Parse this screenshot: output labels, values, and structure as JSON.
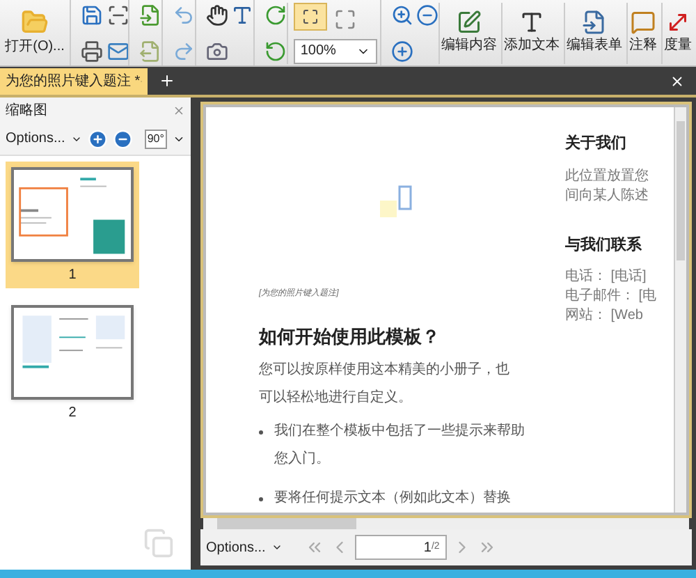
{
  "toolbar": {
    "open_label": "打开(O)...",
    "zoom_value": "100%",
    "buttons": [
      {
        "label": "编辑内容",
        "kind": "edit"
      },
      {
        "label": "添加文本",
        "kind": "text"
      },
      {
        "label": "编辑表单",
        "kind": "form"
      },
      {
        "label": "注释",
        "kind": "comment"
      },
      {
        "label": "度量",
        "kind": "measure"
      }
    ]
  },
  "tabs": [
    {
      "label": "为您的照片键入题注 *",
      "selected": true
    }
  ],
  "sidebar": {
    "title": "缩略图",
    "options": "Options...",
    "rotate_label": "90°",
    "pages": [
      {
        "label": "1",
        "selected": true
      },
      {
        "label": "2",
        "selected": false
      }
    ]
  },
  "document": {
    "about_heading": "关于我们",
    "about_lines": [
      "此位置放置您",
      "间向某人陈述"
    ],
    "contact_heading": "与我们联系",
    "contact_lines": [
      "电话： [电话]",
      "电子邮件： [电",
      "网站： [Web"
    ],
    "caption": "[为您的照片键入题注]",
    "heading": "如何开始使用此模板？",
    "paragraph": "您可以按原样使用这本精美的小册子，也可以轻松地进行自定义。",
    "bullets": [
      "我们在整个模板中包括了一些提示来帮助您入门。",
      "要将任何提示文本（例如此文本）替换"
    ]
  },
  "bottom_bar": {
    "options": "Options...",
    "page_value": "1",
    "page_total": "/2"
  }
}
